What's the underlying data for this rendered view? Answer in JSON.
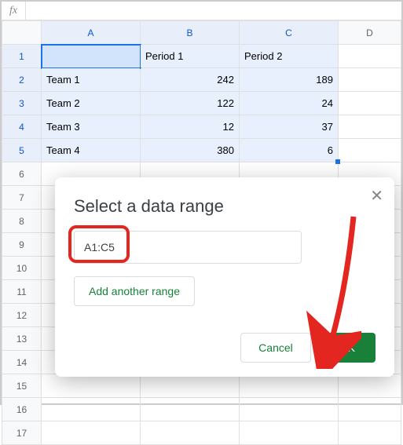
{
  "fx_label": "fx",
  "columns": [
    "A",
    "B",
    "C",
    "D"
  ],
  "rows": [
    "1",
    "2",
    "3",
    "4",
    "5",
    "6",
    "7",
    "8",
    "9",
    "10",
    "11",
    "12",
    "13",
    "14",
    "15",
    "16",
    "17"
  ],
  "grid": {
    "r1": {
      "A": "",
      "B": "Period 1",
      "C": "Period 2"
    },
    "r2": {
      "A": "Team 1",
      "B": "242",
      "C": "189"
    },
    "r3": {
      "A": "Team 2",
      "B": "122",
      "C": "24"
    },
    "r4": {
      "A": "Team 3",
      "B": "12",
      "C": "37"
    },
    "r5": {
      "A": "Team 4",
      "B": "380",
      "C": "6"
    }
  },
  "dialog": {
    "title": "Select a data range",
    "close": "✕",
    "range_value": "A1:C5",
    "add_range": "Add another range",
    "cancel": "Cancel",
    "ok": "OK"
  },
  "chart_data": {
    "type": "table",
    "title": "Select a data range",
    "categories": [
      "Period 1",
      "Period 2"
    ],
    "series": [
      {
        "name": "Team 1",
        "values": [
          242,
          189
        ]
      },
      {
        "name": "Team 2",
        "values": [
          122,
          24
        ]
      },
      {
        "name": "Team 3",
        "values": [
          12,
          37
        ]
      },
      {
        "name": "Team 4",
        "values": [
          380,
          6
        ]
      }
    ]
  }
}
